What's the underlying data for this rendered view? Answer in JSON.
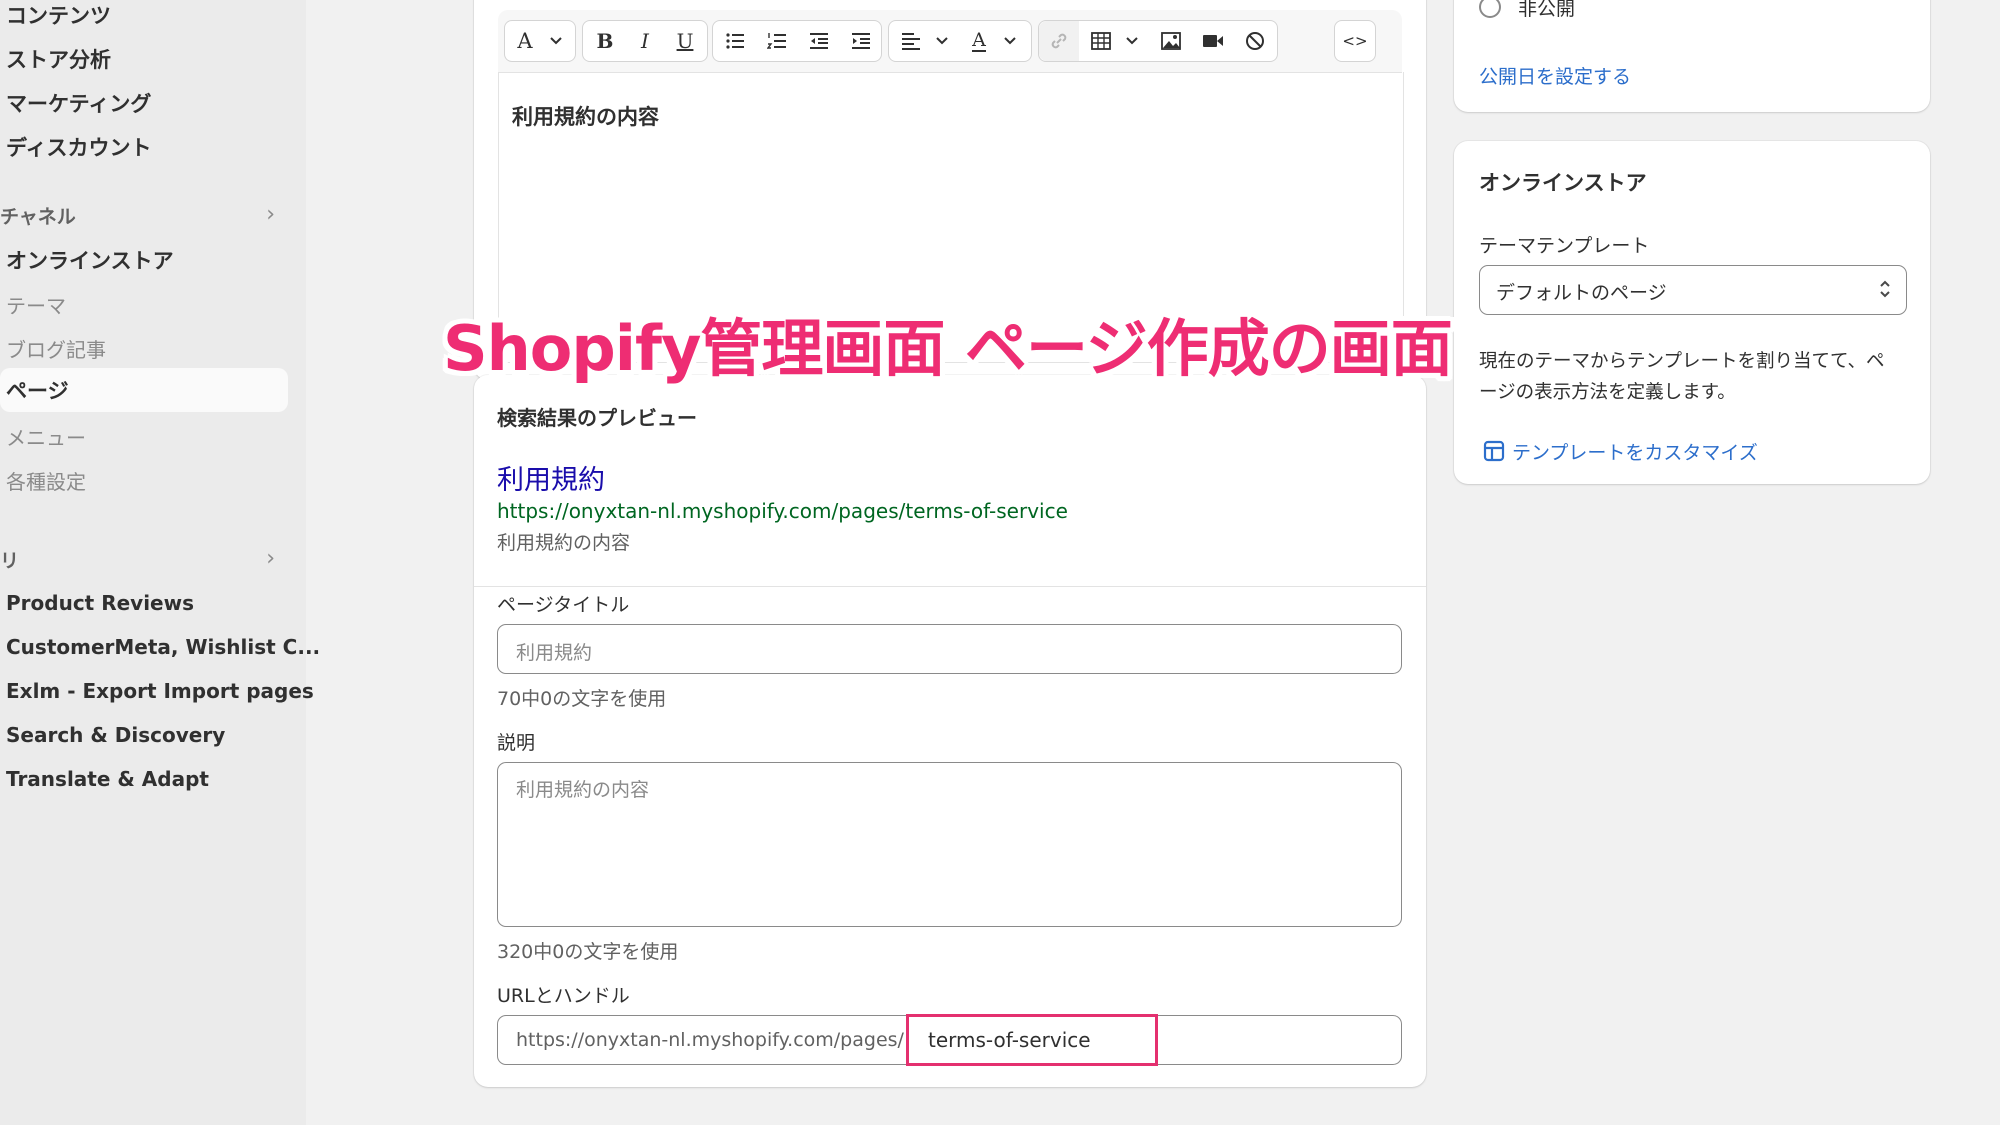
{
  "sidebar": {
    "top_items": [
      "コンテンツ",
      "ストア分析",
      "マーケティング",
      "ディスカウント"
    ],
    "channels_label": "チャネル",
    "online_store": "オンラインストア",
    "sub_items": {
      "theme": "テーマ",
      "blog": "ブログ記事",
      "pages": "ページ",
      "menu": "メニュー",
      "settings": "各種設定"
    },
    "apps_label": "リ",
    "apps": [
      "Product Reviews",
      "CustomerMeta, Wishlist C...",
      "Exlm - Export Import pages",
      "Search & Discovery",
      "Translate & Adapt"
    ]
  },
  "editor": {
    "content": "利用規約の内容",
    "toolbar_icons": [
      "font-icon",
      "bold-icon",
      "italic-icon",
      "underline-icon",
      "bullet-list-icon",
      "numbered-list-icon",
      "outdent-icon",
      "indent-icon",
      "align-icon",
      "text-color-icon",
      "link-icon",
      "table-icon",
      "image-icon",
      "video-icon",
      "clear-format-icon",
      "html-icon"
    ]
  },
  "caption": "Shopify管理画面 ページ作成の画面",
  "seo": {
    "title": "検索結果のプレビュー",
    "preview_title": "利用規約",
    "preview_url": "https://onyxtan-nl.myshopify.com/pages/terms-of-service",
    "preview_desc": "利用規約の内容",
    "page_title_label": "ページタイトル",
    "page_title_placeholder": "利用規約",
    "page_title_count": "70中0の文字を使用",
    "desc_label": "説明",
    "desc_placeholder": "利用規約の内容",
    "desc_count": "320中0の文字を使用",
    "url_label": "URLとハンドル",
    "url_prefix": "https://onyxtan-nl.myshopify.com/pages/",
    "handle": "terms-of-service"
  },
  "visibility": {
    "radio_label": "非公開",
    "set_date_link": "公開日を設定する"
  },
  "online_store_card": {
    "title": "オンラインストア",
    "template_label": "テーマテンプレート",
    "template_value": "デフォルトのページ",
    "description": "現在のテーマからテンプレートを割り当てて、ページの表示方法を定義します。",
    "customize_link": "テンプレートをカスタマイズ"
  },
  "colors": {
    "accent_pink": "#ee2d73",
    "link_blue": "#2c6ecb",
    "serp_title": "#1a0dab",
    "serp_url": "#006621"
  }
}
